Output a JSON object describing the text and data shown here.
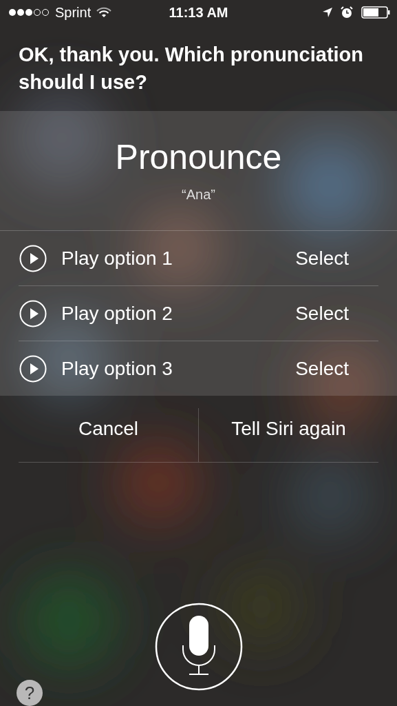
{
  "status_bar": {
    "carrier": "Sprint",
    "time": "11:13 AM"
  },
  "prompt": "OK, thank you. Which pronunciation should I use?",
  "card": {
    "title": "Pronounce",
    "subtitle": "“Ana”",
    "options": [
      {
        "label": "Play option 1",
        "action": "Select"
      },
      {
        "label": "Play option 2",
        "action": "Select"
      },
      {
        "label": "Play option 3",
        "action": "Select"
      }
    ]
  },
  "buttons": [
    {
      "label": "Cancel"
    },
    {
      "label": "Tell Siri again"
    }
  ],
  "help": "?"
}
